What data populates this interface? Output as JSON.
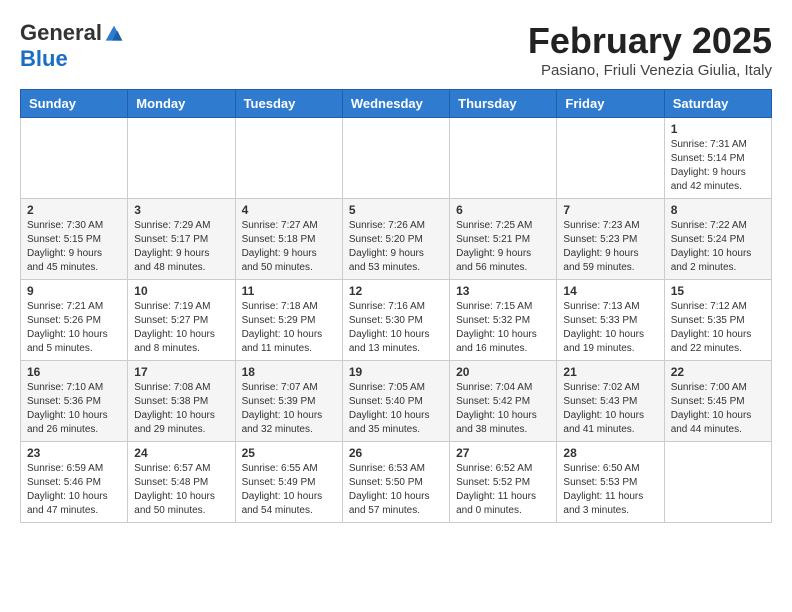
{
  "header": {
    "logo_general": "General",
    "logo_blue": "Blue",
    "month_title": "February 2025",
    "location": "Pasiano, Friuli Venezia Giulia, Italy"
  },
  "days_of_week": [
    "Sunday",
    "Monday",
    "Tuesday",
    "Wednesday",
    "Thursday",
    "Friday",
    "Saturday"
  ],
  "weeks": [
    [
      {
        "day": "",
        "content": ""
      },
      {
        "day": "",
        "content": ""
      },
      {
        "day": "",
        "content": ""
      },
      {
        "day": "",
        "content": ""
      },
      {
        "day": "",
        "content": ""
      },
      {
        "day": "",
        "content": ""
      },
      {
        "day": "1",
        "content": "Sunrise: 7:31 AM\nSunset: 5:14 PM\nDaylight: 9 hours and 42 minutes."
      }
    ],
    [
      {
        "day": "2",
        "content": "Sunrise: 7:30 AM\nSunset: 5:15 PM\nDaylight: 9 hours and 45 minutes."
      },
      {
        "day": "3",
        "content": "Sunrise: 7:29 AM\nSunset: 5:17 PM\nDaylight: 9 hours and 48 minutes."
      },
      {
        "day": "4",
        "content": "Sunrise: 7:27 AM\nSunset: 5:18 PM\nDaylight: 9 hours and 50 minutes."
      },
      {
        "day": "5",
        "content": "Sunrise: 7:26 AM\nSunset: 5:20 PM\nDaylight: 9 hours and 53 minutes."
      },
      {
        "day": "6",
        "content": "Sunrise: 7:25 AM\nSunset: 5:21 PM\nDaylight: 9 hours and 56 minutes."
      },
      {
        "day": "7",
        "content": "Sunrise: 7:23 AM\nSunset: 5:23 PM\nDaylight: 9 hours and 59 minutes."
      },
      {
        "day": "8",
        "content": "Sunrise: 7:22 AM\nSunset: 5:24 PM\nDaylight: 10 hours and 2 minutes."
      }
    ],
    [
      {
        "day": "9",
        "content": "Sunrise: 7:21 AM\nSunset: 5:26 PM\nDaylight: 10 hours and 5 minutes."
      },
      {
        "day": "10",
        "content": "Sunrise: 7:19 AM\nSunset: 5:27 PM\nDaylight: 10 hours and 8 minutes."
      },
      {
        "day": "11",
        "content": "Sunrise: 7:18 AM\nSunset: 5:29 PM\nDaylight: 10 hours and 11 minutes."
      },
      {
        "day": "12",
        "content": "Sunrise: 7:16 AM\nSunset: 5:30 PM\nDaylight: 10 hours and 13 minutes."
      },
      {
        "day": "13",
        "content": "Sunrise: 7:15 AM\nSunset: 5:32 PM\nDaylight: 10 hours and 16 minutes."
      },
      {
        "day": "14",
        "content": "Sunrise: 7:13 AM\nSunset: 5:33 PM\nDaylight: 10 hours and 19 minutes."
      },
      {
        "day": "15",
        "content": "Sunrise: 7:12 AM\nSunset: 5:35 PM\nDaylight: 10 hours and 22 minutes."
      }
    ],
    [
      {
        "day": "16",
        "content": "Sunrise: 7:10 AM\nSunset: 5:36 PM\nDaylight: 10 hours and 26 minutes."
      },
      {
        "day": "17",
        "content": "Sunrise: 7:08 AM\nSunset: 5:38 PM\nDaylight: 10 hours and 29 minutes."
      },
      {
        "day": "18",
        "content": "Sunrise: 7:07 AM\nSunset: 5:39 PM\nDaylight: 10 hours and 32 minutes."
      },
      {
        "day": "19",
        "content": "Sunrise: 7:05 AM\nSunset: 5:40 PM\nDaylight: 10 hours and 35 minutes."
      },
      {
        "day": "20",
        "content": "Sunrise: 7:04 AM\nSunset: 5:42 PM\nDaylight: 10 hours and 38 minutes."
      },
      {
        "day": "21",
        "content": "Sunrise: 7:02 AM\nSunset: 5:43 PM\nDaylight: 10 hours and 41 minutes."
      },
      {
        "day": "22",
        "content": "Sunrise: 7:00 AM\nSunset: 5:45 PM\nDaylight: 10 hours and 44 minutes."
      }
    ],
    [
      {
        "day": "23",
        "content": "Sunrise: 6:59 AM\nSunset: 5:46 PM\nDaylight: 10 hours and 47 minutes."
      },
      {
        "day": "24",
        "content": "Sunrise: 6:57 AM\nSunset: 5:48 PM\nDaylight: 10 hours and 50 minutes."
      },
      {
        "day": "25",
        "content": "Sunrise: 6:55 AM\nSunset: 5:49 PM\nDaylight: 10 hours and 54 minutes."
      },
      {
        "day": "26",
        "content": "Sunrise: 6:53 AM\nSunset: 5:50 PM\nDaylight: 10 hours and 57 minutes."
      },
      {
        "day": "27",
        "content": "Sunrise: 6:52 AM\nSunset: 5:52 PM\nDaylight: 11 hours and 0 minutes."
      },
      {
        "day": "28",
        "content": "Sunrise: 6:50 AM\nSunset: 5:53 PM\nDaylight: 11 hours and 3 minutes."
      },
      {
        "day": "",
        "content": ""
      }
    ]
  ]
}
